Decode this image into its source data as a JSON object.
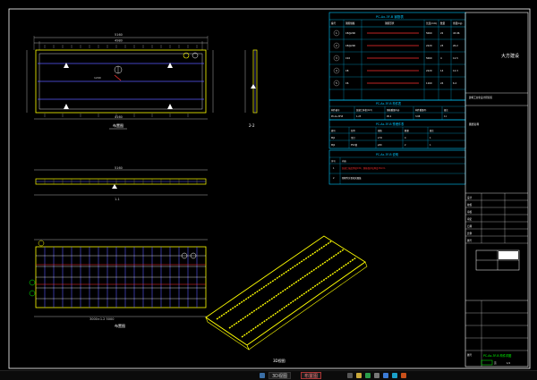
{
  "drawing": {
    "views": {
      "section_2_2": "2-2",
      "section_1_1": "1-1",
      "plan_label": "布置图",
      "iso_label": "3D视图"
    },
    "dims": {
      "plan_overall": "5160",
      "plan_inner": "4980",
      "plan_inner_lower": "4160",
      "mid_overall": "5160",
      "mid_inner": "4980",
      "rebar_overall": "5160",
      "rebar_inner": "4980",
      "plan_inner_value": "1200",
      "plan_cut": "A-A",
      "rebar_note": "3000×1.2 5000",
      "mid_mark": "1-1"
    },
    "tables": {
      "rebar_table_title": "PC-Ax-3F-B 钢筋表",
      "rebar_table_headers": [
        "编号",
        "钢筋规格",
        "钢筋形状",
        "长度(mm)",
        "数量",
        "重量(kg)",
        "备注"
      ],
      "rebar_rows": [
        {
          "id": "1",
          "spec": "C8@200",
          "len": "5060",
          "qty": "22",
          "wt": "43.96",
          "note": "11"
        },
        {
          "id": "2",
          "spec": "C8@200",
          "len": "2220",
          "qty": "23",
          "wt": "20.2",
          "note": "11"
        },
        {
          "id": "3",
          "spec": "C10",
          "len": "5060",
          "qty": "4",
          "wt": "12.5",
          "note": "11"
        },
        {
          "id": "4",
          "spec": "C8",
          "len": "2220",
          "qty": "14",
          "wt": "12.3",
          "note": "11"
        },
        {
          "id": "5",
          "spec": "C6",
          "len": "1160",
          "qty": "24",
          "wt": "6.2",
          "note": "11"
        }
      ],
      "component_title": "PC-Ax-3F-B 构件表",
      "component_headers": [
        "构件编号",
        "混凝土体积(m3)",
        "钢筋重量(kg)",
        "构件重量(t)",
        "备注"
      ],
      "component_row": [
        "PC-Ax-3F-B",
        "1.23",
        "95.1",
        "3.08",
        "11"
      ],
      "embedded_title": "PC-Ax-3F-B 预埋件表",
      "embedded_headers": [
        "编号",
        "名称",
        "规格",
        "数量",
        "备注"
      ],
      "embedded_rows": [
        {
          "c1": "MJ1",
          "c2": "吊钉",
          "c3": "2.5t",
          "c4": "4",
          "c5": "1"
        },
        {
          "c1": "MJ2",
          "c2": "PVC管",
          "c3": "φ50",
          "c4": "2",
          "c5": "1"
        }
      ],
      "notes_title": "PC-Ax-3F-B 说明",
      "notes_headers": [
        "序号",
        "内容"
      ],
      "notes_rows": [
        {
          "n": "1",
          "text": "混凝土强度等级C30，钢筋保护层厚度15mm"
        },
        {
          "n": "2",
          "text": "预埋件详见相关图集"
        }
      ]
    },
    "title_block": {
      "company": "大方建设",
      "company_sub": "建筑工业化设计研究院",
      "field_label_1": "图纸名称",
      "rows": [
        "设计",
        "校核",
        "审核",
        "审定",
        "日期",
        "比例",
        "图号"
      ],
      "drawing_no_label": "图号",
      "drawing_no": "PC-Ax-3F-B 构件详图",
      "sheet_label": "页",
      "sheet_no": "1/1"
    }
  },
  "taskbar": {
    "buttons": [
      "3D视图",
      "布置图"
    ],
    "active": "布置图"
  },
  "colors": {
    "background": "#000000",
    "outline": "#ffffff",
    "dim": "#d8d8d8",
    "slab": "#ffff00",
    "rebar_blue": "#5a5aff",
    "rebar_red": "#ff3030",
    "table_cyan": "#00c8ff",
    "title_block_green": "#00ff00"
  }
}
